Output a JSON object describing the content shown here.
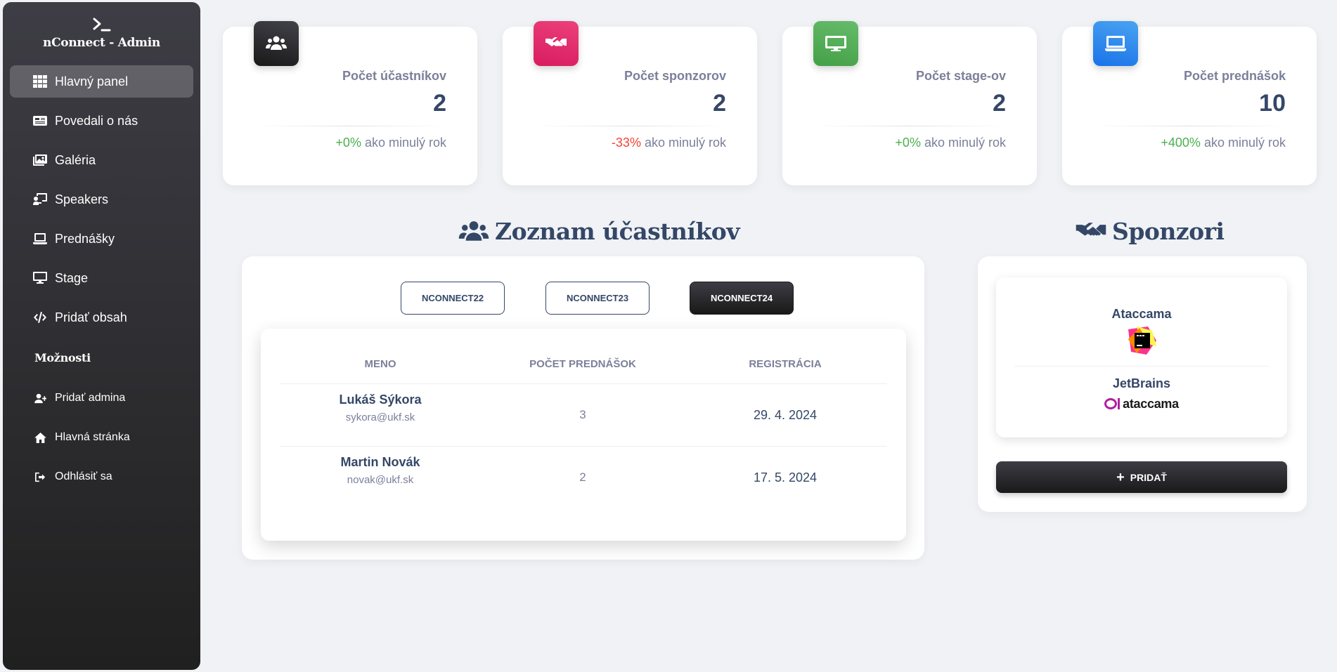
{
  "sidebar": {
    "title": "nConnect - Admin",
    "items": [
      {
        "label": "Hlavný panel",
        "icon": "grid-icon",
        "active": true
      },
      {
        "label": "Povedali o nás",
        "icon": "newspaper-icon"
      },
      {
        "label": "Galéria",
        "icon": "images-icon"
      },
      {
        "label": "Speakers",
        "icon": "chalkboard-user-icon"
      },
      {
        "label": "Prednášky",
        "icon": "laptop-icon"
      },
      {
        "label": "Stage",
        "icon": "desktop-icon"
      },
      {
        "label": "Pridať obsah",
        "icon": "code-icon"
      }
    ],
    "section_label": "Možnosti",
    "options": [
      {
        "label": "Pridať admina",
        "icon": "user-plus-icon"
      },
      {
        "label": "Hlavná stránka",
        "icon": "home-icon"
      },
      {
        "label": "Odhlásiť sa",
        "icon": "sign-out-icon"
      }
    ]
  },
  "stats": [
    {
      "label": "Počet účastníkov",
      "value": "2",
      "change": "+0%",
      "change_type": "positive",
      "suffix": " ako minulý rok",
      "color": "#262626",
      "icon": "users-icon"
    },
    {
      "label": "Počet sponzorov",
      "value": "2",
      "change": "-33%",
      "change_type": "negative",
      "suffix": " ako minulý rok",
      "color": "#e91e63",
      "icon": "handshake-icon"
    },
    {
      "label": "Počet stage-ov",
      "value": "2",
      "change": "+0%",
      "change_type": "positive",
      "suffix": " ako minulý rok",
      "color": "#4caf50",
      "icon": "desktop-icon"
    },
    {
      "label": "Počet prednášok",
      "value": "10",
      "change": "+400%",
      "change_type": "positive",
      "suffix": " ako minulý rok",
      "color": "#1a73e8",
      "icon": "laptop-icon"
    }
  ],
  "participants": {
    "title": "Zoznam účastníkov",
    "tabs": [
      "NCONNECT22",
      "NCONNECT23",
      "NCONNECT24"
    ],
    "active_tab": "NCONNECT24",
    "columns": [
      "Meno",
      "Počet prednášok",
      "Registrácia"
    ],
    "rows": [
      {
        "name": "Lukáš Sýkora",
        "email": "sykora@ukf.sk",
        "talks": "3",
        "registered": "29. 4. 2024"
      },
      {
        "name": "Martin Novák",
        "email": "novak@ukf.sk",
        "talks": "2",
        "registered": "17. 5. 2024"
      }
    ]
  },
  "sponsors": {
    "title": "Sponzori",
    "items": [
      {
        "name": "Ataccama",
        "logo": "jetbrains-logo"
      },
      {
        "name": "JetBrains",
        "logo": "ataccama-logo",
        "logo_text": "ataccama"
      }
    ],
    "add_label": "PRIDAŤ"
  }
}
